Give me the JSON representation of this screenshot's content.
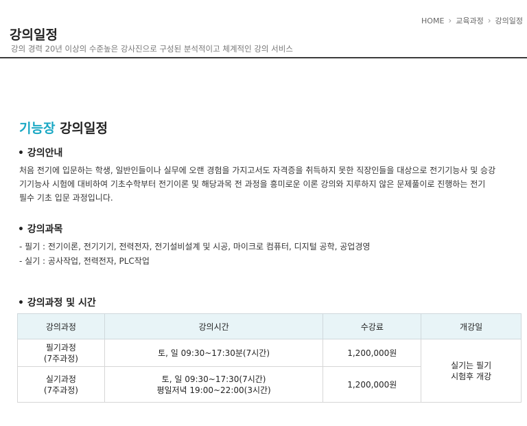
{
  "breadcrumb": [
    "HOME",
    "교육과정",
    "강의일정"
  ],
  "header": {
    "title": "강의일정",
    "subtitle": "강의 경력 20년 이상의 수준높은 강사진으로 구성된 분석적이고 체계적인 강의 서비스"
  },
  "section": {
    "accent": "기능장",
    "title": "강의일정"
  },
  "guide": {
    "heading": "강의안내",
    "lines": [
      "처음 전기에 입문하는 학생, 일반인들이나 실무에 오랜 경험을 가지고서도 자격증을 취득하지 못한 직장인들을 대상으로 전기기능사 및 승강",
      "기기능사 시험에 대비하여 기초수학부터 전기이론 및 해당과목 전 과정을 흥미로운 이론 강의와 지루하지 않은 문제풀이로 진행하는 전기",
      "필수 기초 입문 과정입니다."
    ]
  },
  "subjects": {
    "heading": "강의과목",
    "items": [
      "필기 : 전기이론, 전기기기, 전력전자, 전기설비설계 및 시공, 마이크로 컴퓨터, 디지털 공학, 공업경영",
      "실기 : 공사작업, 전력전자, PLC작업"
    ]
  },
  "schedule": {
    "heading": "강의과정 및 시간",
    "columns": [
      "강의과정",
      "강의시간",
      "수강료",
      "개강일"
    ],
    "rows": [
      {
        "course": [
          "필기과정",
          "(7주과정)"
        ],
        "time": [
          "토, 일 09:30~17:30분(7시간)"
        ],
        "fee": "1,200,000원"
      },
      {
        "course": [
          "실기과정",
          "(7주과정)"
        ],
        "time": [
          "토, 일 09:30~17:30(7시간)",
          "평일저녁 19:00~22:00(3시간)"
        ],
        "fee": "1,200,000원"
      }
    ],
    "start": [
      "실기는 필기",
      "시험후 개강"
    ]
  }
}
